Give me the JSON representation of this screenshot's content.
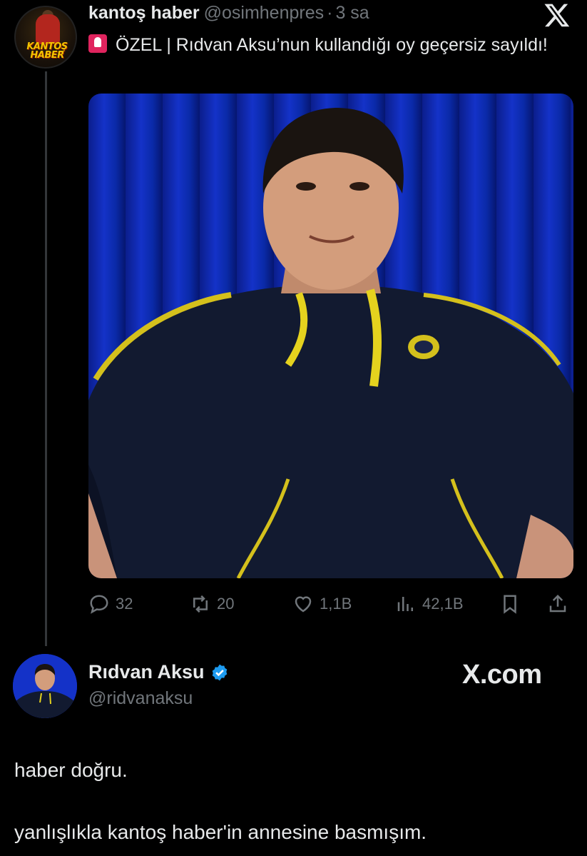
{
  "tweet": {
    "display_name": "kantoş haber",
    "handle": "@osimhenpres",
    "time_sep": "·",
    "time": "3 sa",
    "text": "ÖZEL | Rıdvan Aksu’nun kullandığı oy geçersiz sayıldı!",
    "avatar_logo_text": "KANTOŞ HABER",
    "stats": {
      "replies": "32",
      "retweets": "20",
      "likes": "1,1B",
      "views": "42,1B"
    }
  },
  "reply": {
    "display_name": "Rıdvan Aksu",
    "handle": "@ridvanaksu",
    "watermark": "X.com",
    "lines": [
      "haber doğru.",
      "yanlışlıkla kantoş haber'in annesine basmışım."
    ]
  },
  "icons": {
    "x_logo": "x-logo-icon",
    "siren": "siren-emoji-icon",
    "reply": "reply-bubble-icon",
    "retweet": "retweet-icon",
    "like": "heart-icon",
    "views": "views-bar-chart-icon",
    "bookmark": "bookmark-icon",
    "share": "share-icon",
    "verified": "verified-badge-icon"
  },
  "colors": {
    "background": "#000000",
    "text_primary": "#e7e9ea",
    "text_secondary": "#71767b",
    "verified_blue": "#1d9bf0",
    "thread_line": "#333639"
  }
}
